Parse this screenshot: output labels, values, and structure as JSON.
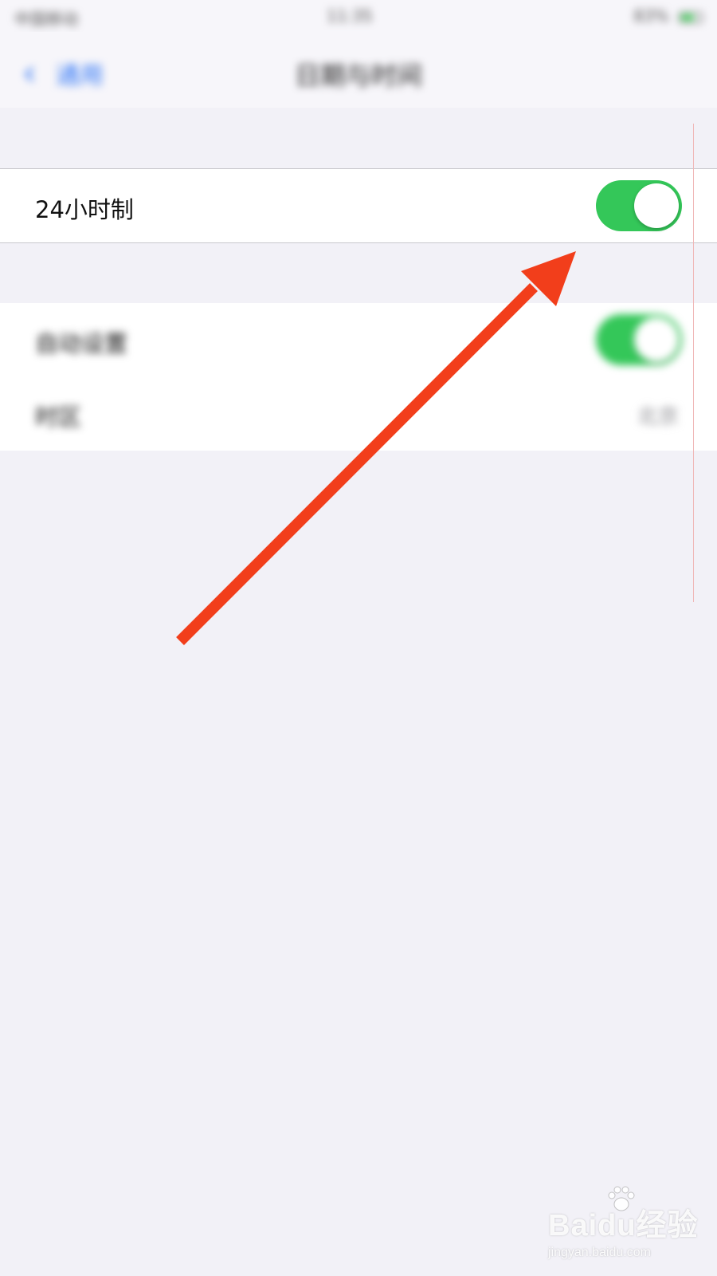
{
  "status_bar": {
    "carrier": "中国移动",
    "time": "11:35",
    "battery": "83%"
  },
  "nav": {
    "back_label": "通用",
    "title": "日期与时间"
  },
  "settings": {
    "twenty_four_hour": {
      "label": "24小时制",
      "enabled": true
    },
    "auto_set": {
      "label": "自动设置",
      "enabled": true
    },
    "timezone": {
      "label": "时区",
      "value": "北京"
    }
  },
  "annotation": {
    "arrow_color": "#f23e1b"
  },
  "colors": {
    "toggle_on": "#34c759",
    "accent": "#3478f6",
    "background": "#f2f1f7"
  },
  "watermark": {
    "logo": "Baidu经验",
    "url": "jingyan.baidu.com"
  }
}
